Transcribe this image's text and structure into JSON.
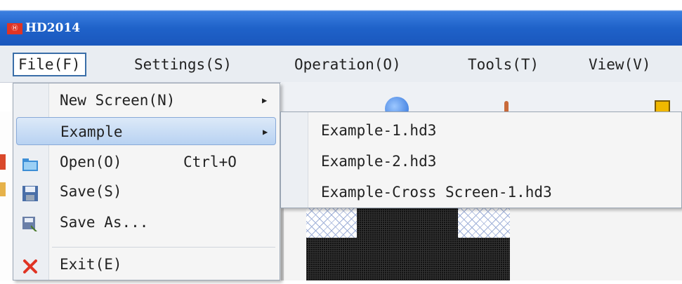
{
  "app": {
    "title": "HD2014",
    "icon_text": "Ⓗ"
  },
  "menubar": {
    "items": [
      {
        "label": "File(F)",
        "active": true
      },
      {
        "label": "Settings(S)"
      },
      {
        "label": "Operation(O)"
      },
      {
        "label": "Tools(T)"
      },
      {
        "label": "View(V)"
      }
    ]
  },
  "file_menu": {
    "items": [
      {
        "label": "New Screen(N)",
        "submenu": true
      },
      {
        "label": "Example",
        "submenu": true,
        "highlighted": true
      },
      {
        "label": "Open(O)",
        "shortcut": "Ctrl+O",
        "icon": "folder-open-icon"
      },
      {
        "label": "Save(S)",
        "icon": "floppy-disk-icon"
      },
      {
        "label": "Save As...",
        "icon": "save-as-icon"
      },
      {
        "label": "Exit(E)",
        "icon": "close-x-icon"
      }
    ]
  },
  "example_submenu": {
    "items": [
      {
        "label": "Example-1.hd3"
      },
      {
        "label": "Example-2.hd3"
      },
      {
        "label": "Example-Cross Screen-1.hd3"
      }
    ]
  },
  "colors": {
    "titlebar": "#1f62c9",
    "menu_highlight": "#b8d2f2",
    "exit_icon": "#e03424"
  }
}
